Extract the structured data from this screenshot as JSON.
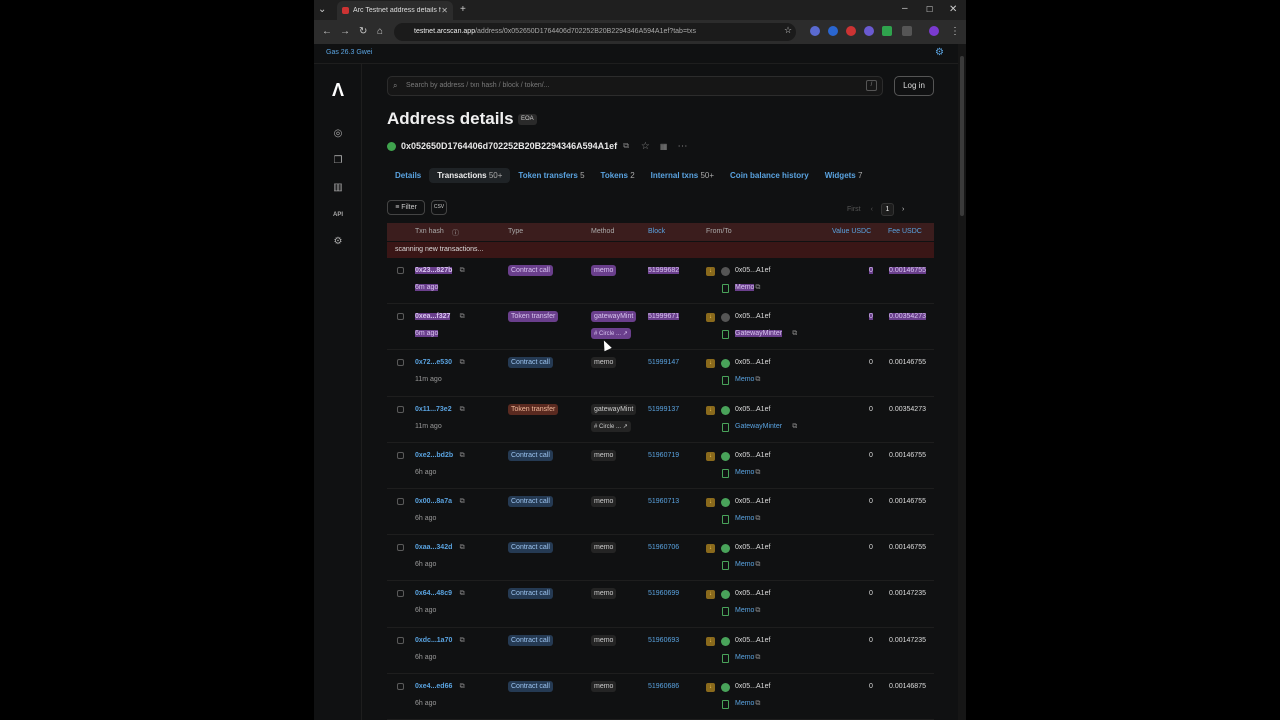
{
  "browser": {
    "tab_title": "Arc Testnet address details for",
    "url_domain": "testnet.arcscan.app",
    "url_path": "/address/0x052650D1764406d702252B20B2294346A594A1ef?tab=txs"
  },
  "topbar": {
    "gas": "Gas 26.3 Gwei"
  },
  "search": {
    "placeholder": "Search by address / txn hash / block / token/..."
  },
  "login": "Log in",
  "page": {
    "title": "Address details",
    "badge": "EOA",
    "address": "0x052650D1764406d702252B20B2294346A594A1ef"
  },
  "tabs": [
    {
      "label": "Details",
      "count": ""
    },
    {
      "label": "Transactions",
      "count": "50+"
    },
    {
      "label": "Token transfers",
      "count": "5"
    },
    {
      "label": "Tokens",
      "count": "2"
    },
    {
      "label": "Internal txns",
      "count": "50+"
    },
    {
      "label": "Coin balance history",
      "count": ""
    },
    {
      "label": "Widgets",
      "count": "7"
    }
  ],
  "filter_label": "Filter",
  "csv_label": "CSV",
  "pager": {
    "first": "First",
    "page": "1"
  },
  "columns": {
    "hash": "Txn hash",
    "type": "Type",
    "method": "Method",
    "block": "Block",
    "fromto": "From/To",
    "value": "Value USDC",
    "fee": "Fee USDC"
  },
  "scanning": "scanning new transactions...",
  "rows": [
    {
      "hash": "0x23...827b",
      "age": "6m ago",
      "type": "Contract call",
      "method": "memo",
      "circle": "",
      "block": "51999682",
      "from": "0x05...A1ef",
      "to": "Memo",
      "value": "0",
      "fee": "0.00146755"
    },
    {
      "hash": "0xea...f327",
      "age": "6m ago",
      "type": "Token transfer",
      "method": "gatewayMint",
      "circle": "Circle ...",
      "block": "51999671",
      "from": "0x05...A1ef",
      "to": "GatewayMinter",
      "value": "0",
      "fee": "0.00354273"
    },
    {
      "hash": "0x72...e530",
      "age": "11m ago",
      "type": "Contract call",
      "method": "memo",
      "circle": "",
      "block": "51999147",
      "from": "0x05...A1ef",
      "to": "Memo",
      "value": "0",
      "fee": "0.00146755"
    },
    {
      "hash": "0x11...73e2",
      "age": "11m ago",
      "type": "Token transfer",
      "method": "gatewayMint",
      "circle": "Circle ...",
      "block": "51999137",
      "from": "0x05...A1ef",
      "to": "GatewayMinter",
      "value": "0",
      "fee": "0.00354273"
    },
    {
      "hash": "0xe2...bd2b",
      "age": "6h ago",
      "type": "Contract call",
      "method": "memo",
      "circle": "",
      "block": "51960719",
      "from": "0x05...A1ef",
      "to": "Memo",
      "value": "0",
      "fee": "0.00146755"
    },
    {
      "hash": "0x00...8a7a",
      "age": "6h ago",
      "type": "Contract call",
      "method": "memo",
      "circle": "",
      "block": "51960713",
      "from": "0x05...A1ef",
      "to": "Memo",
      "value": "0",
      "fee": "0.00146755"
    },
    {
      "hash": "0xaa...342d",
      "age": "6h ago",
      "type": "Contract call",
      "method": "memo",
      "circle": "",
      "block": "51960706",
      "from": "0x05...A1ef",
      "to": "Memo",
      "value": "0",
      "fee": "0.00146755"
    },
    {
      "hash": "0x64...48c9",
      "age": "6h ago",
      "type": "Contract call",
      "method": "memo",
      "circle": "",
      "block": "51960699",
      "from": "0x05...A1ef",
      "to": "Memo",
      "value": "0",
      "fee": "0.00147235"
    },
    {
      "hash": "0xdc...1a70",
      "age": "6h ago",
      "type": "Contract call",
      "method": "memo",
      "circle": "",
      "block": "51960693",
      "from": "0x05...A1ef",
      "to": "Memo",
      "value": "0",
      "fee": "0.00147235"
    },
    {
      "hash": "0xe4...ed66",
      "age": "6h ago",
      "type": "Contract call",
      "method": "memo",
      "circle": "",
      "block": "51960686",
      "from": "0x05...A1ef",
      "to": "Memo",
      "value": "0",
      "fee": "0.00146875"
    }
  ]
}
